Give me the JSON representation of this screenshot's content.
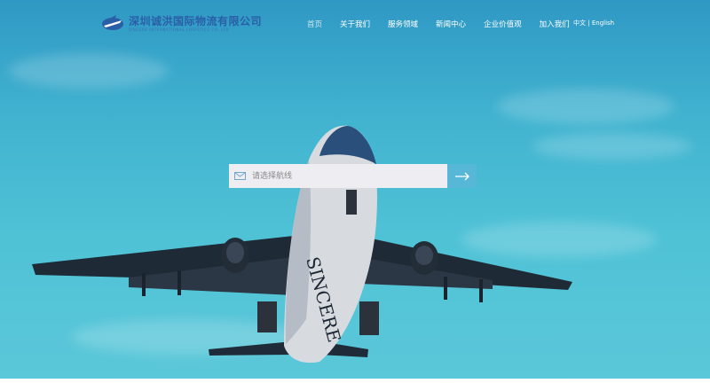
{
  "logo": {
    "name_cn": "深圳诚洪国际物流有限公司",
    "name_en": "SINCERE INTERNATIONAL LOGISTICS CO.,LTD"
  },
  "nav": {
    "items": [
      {
        "label": "首页"
      },
      {
        "label": "关于我们"
      },
      {
        "label": "服务领域"
      },
      {
        "label": "新闻中心"
      },
      {
        "label": "企业价值观"
      },
      {
        "label": "加入我们"
      }
    ]
  },
  "lang": {
    "cn": "中文",
    "sep": "|",
    "en": "English"
  },
  "search": {
    "placeholder": "请选择航线"
  },
  "hero": {
    "plane_text": "SINCERE"
  },
  "icons": [
    "logo-plane-icon",
    "mail-icon",
    "arrow-right-icon"
  ],
  "colors": {
    "sky": "#41b3d0",
    "search_button": "#56b7d6",
    "logo": "#2a5fa8"
  }
}
